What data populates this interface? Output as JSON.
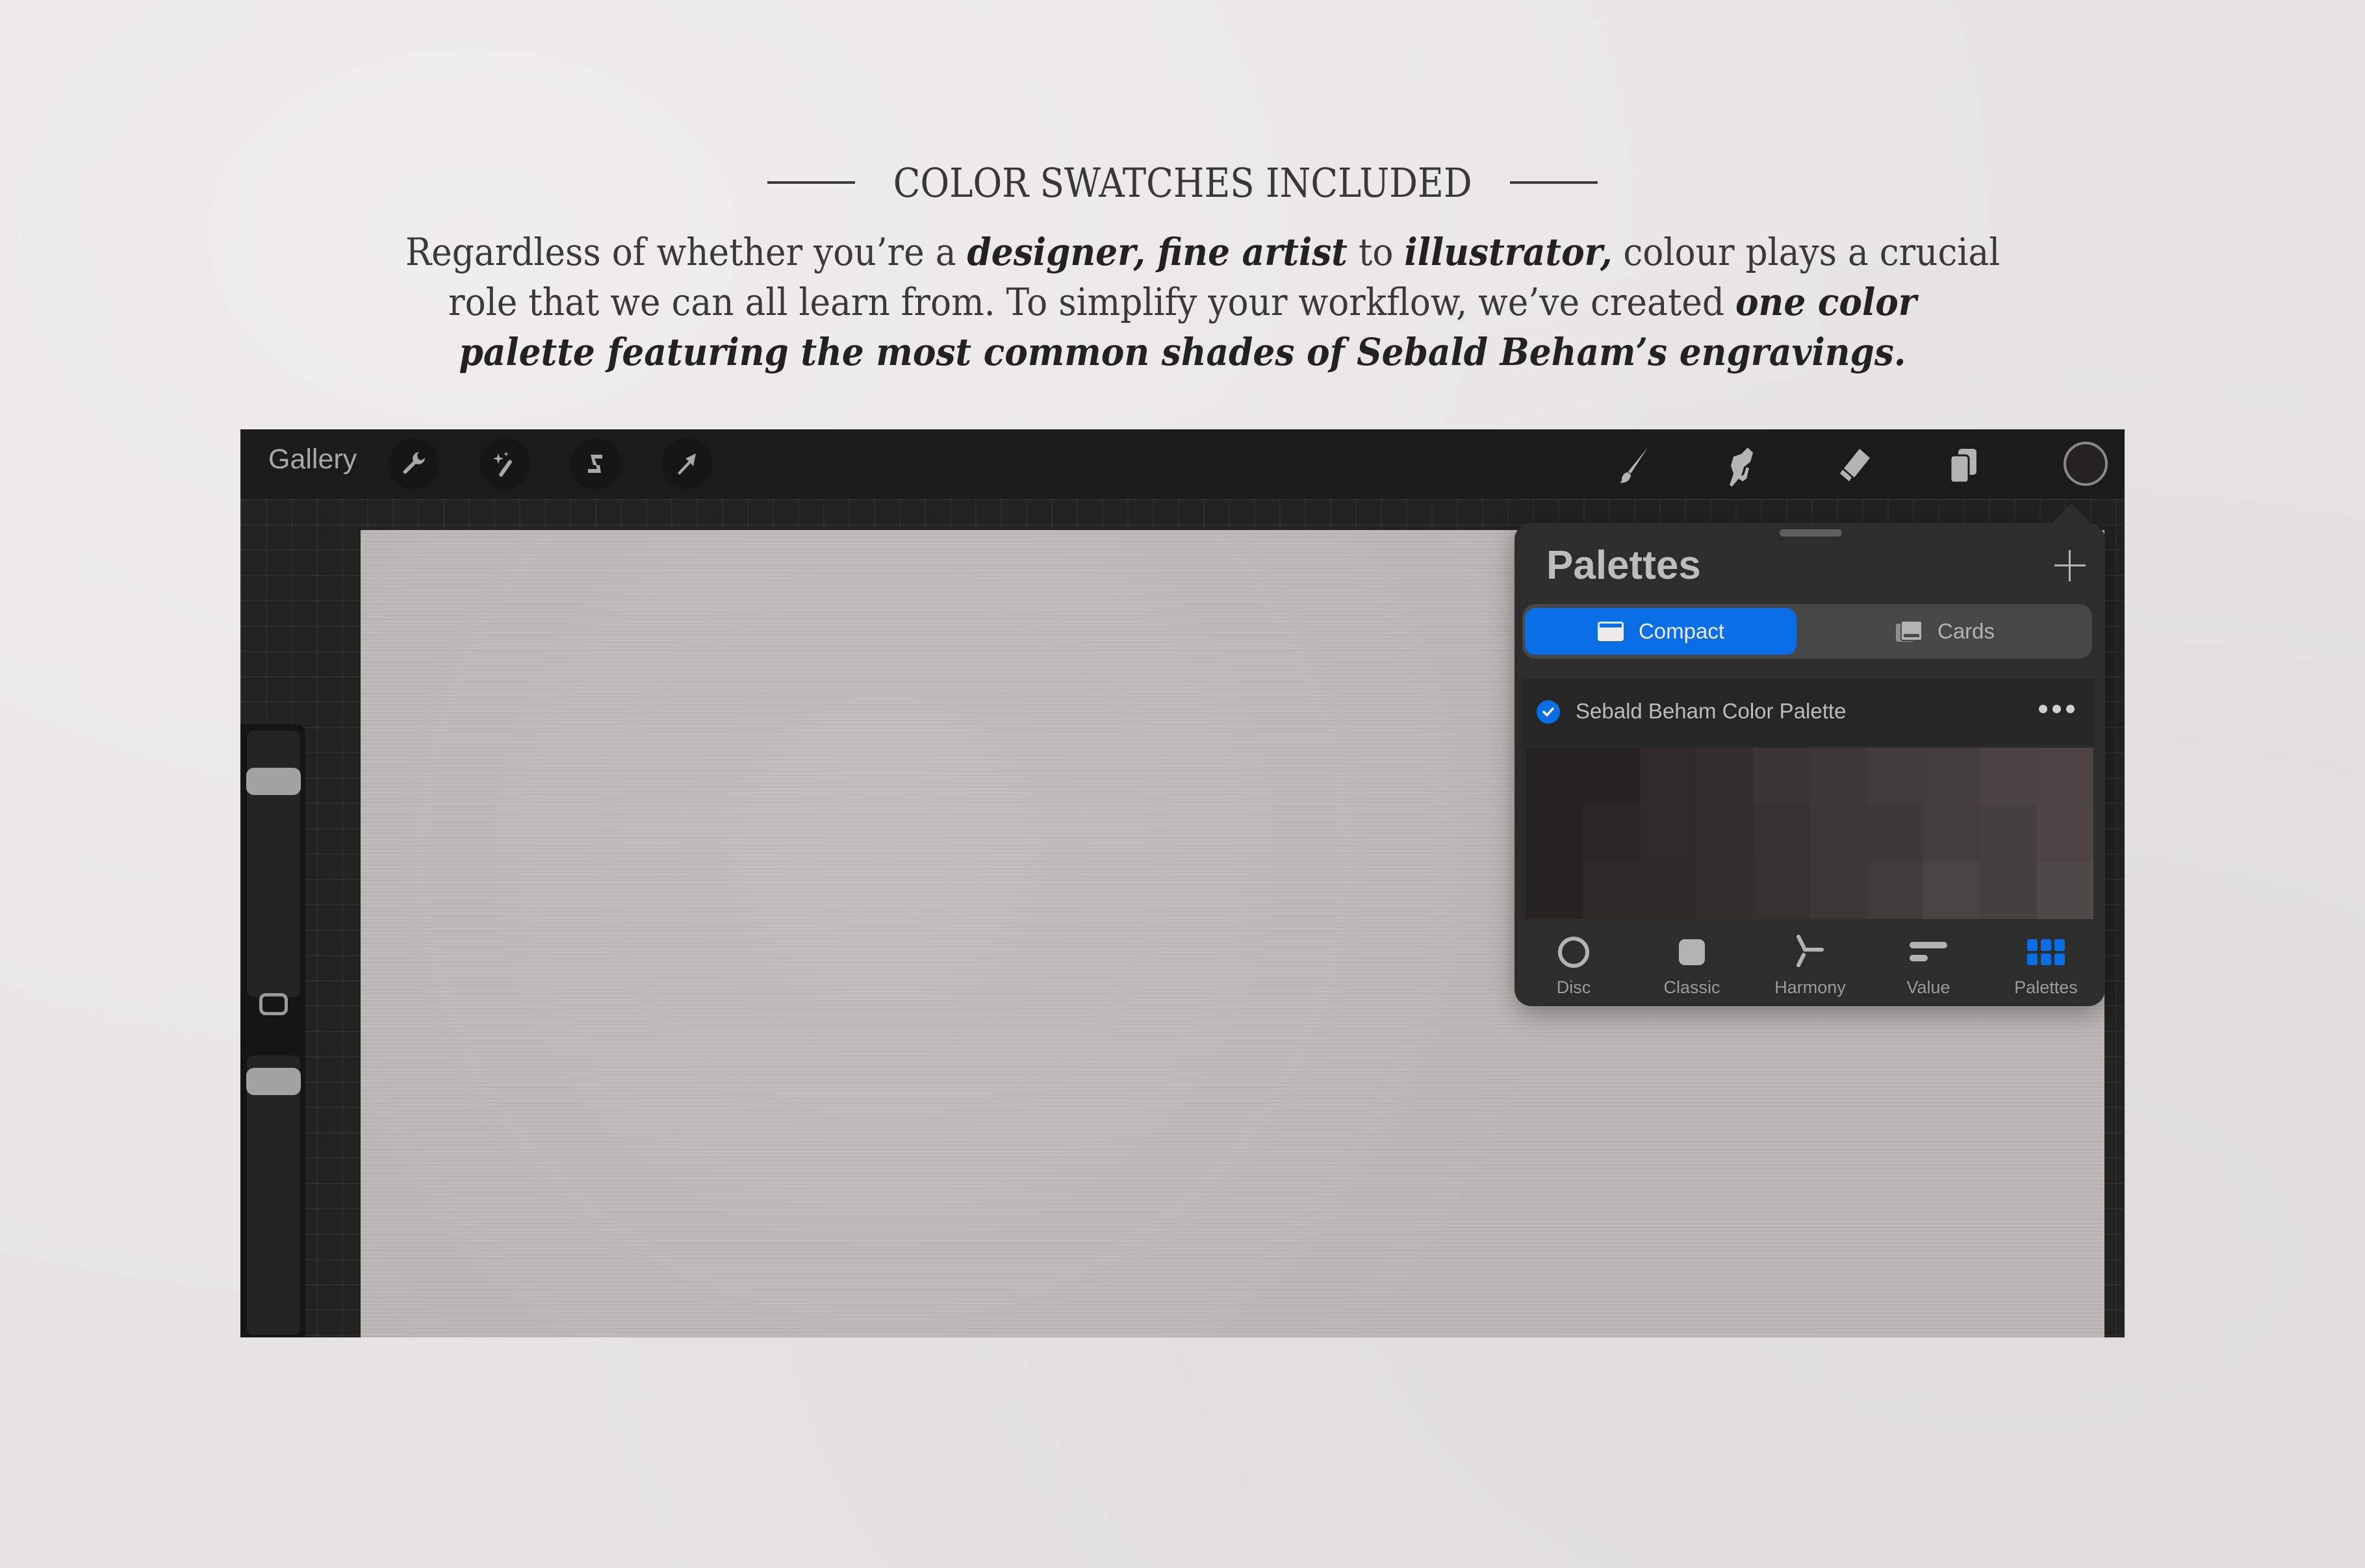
{
  "header": {
    "title": "COLOR SWATCHES INCLUDED",
    "intro": {
      "line1": [
        {
          "t": "Regardless of whether you’re a ",
          "em": false
        },
        {
          "t": "designer, fine artist",
          "em": true
        },
        {
          "t": " to ",
          "em": false
        },
        {
          "t": "illustrator,",
          "em": true
        },
        {
          "t": " colour plays a crucial",
          "em": false
        }
      ],
      "line2": [
        {
          "t": "role that we can all learn from. To simplify your workflow, we’ve created ",
          "em": false
        },
        {
          "t": "one color",
          "em": true
        }
      ],
      "line3": [
        {
          "t": "palette featuring the most common shades of Sebald Beham’s engravings.",
          "em": true
        }
      ]
    }
  },
  "app": {
    "toolbar": {
      "gallery_label": "Gallery",
      "left_tools": [
        {
          "name": "actions",
          "icon": "wrench-icon"
        },
        {
          "name": "adjustments",
          "icon": "magic-wand-icon"
        },
        {
          "name": "selection",
          "icon": "selection-s-icon"
        },
        {
          "name": "transform",
          "icon": "arrow-cursor-icon"
        }
      ],
      "right_tools": [
        {
          "name": "brush",
          "icon": "paintbrush-icon"
        },
        {
          "name": "smudge",
          "icon": "smudge-finger-icon"
        },
        {
          "name": "eraser",
          "icon": "eraser-icon"
        },
        {
          "name": "layers",
          "icon": "layers-icon"
        }
      ],
      "current_color": "#242222"
    },
    "sidebar": {
      "brush_size_fraction": 0.85,
      "opacity_fraction": 0.95
    },
    "palettes_panel": {
      "title": "Palettes",
      "add_icon": "plus-icon",
      "view_modes": [
        {
          "label": "Compact",
          "icon": "compact-card-icon",
          "active": true
        },
        {
          "label": "Cards",
          "icon": "cards-stack-icon",
          "active": false
        }
      ],
      "palette": {
        "name": "Sebald Beham Color Palette",
        "is_default": true,
        "more_icon": "ellipsis-icon",
        "swatches": [
          [
            "#262221",
            "#272322",
            "#302b2a",
            "#332e2d",
            "#3b3635",
            "#3c3636",
            "#433c3c",
            "#453e3e",
            "#4a4341",
            "#4c4443"
          ],
          [
            "#262221",
            "#2b2726",
            "#302b2a",
            "#332e2d",
            "#373231",
            "#3d3737",
            "#3e3838",
            "#443e3d",
            "#453f3e",
            "#4d4443"
          ],
          [
            "#262221",
            "#2d2928",
            "#2e2a29",
            "#342f2e",
            "#37322f",
            "#3d3636",
            "#403a3a",
            "#4a4443",
            "#463f3f",
            "#4f4947"
          ]
        ]
      },
      "tabs": [
        {
          "label": "Disc",
          "icon": "disc-icon",
          "active": false
        },
        {
          "label": "Classic",
          "icon": "classic-square-icon",
          "active": false
        },
        {
          "label": "Harmony",
          "icon": "harmony-icon",
          "active": false
        },
        {
          "label": "Value",
          "icon": "value-sliders-icon",
          "active": false
        },
        {
          "label": "Palettes",
          "icon": "palettes-grid-icon",
          "active": true
        }
      ],
      "accent_color": "#0a6ee6"
    }
  }
}
